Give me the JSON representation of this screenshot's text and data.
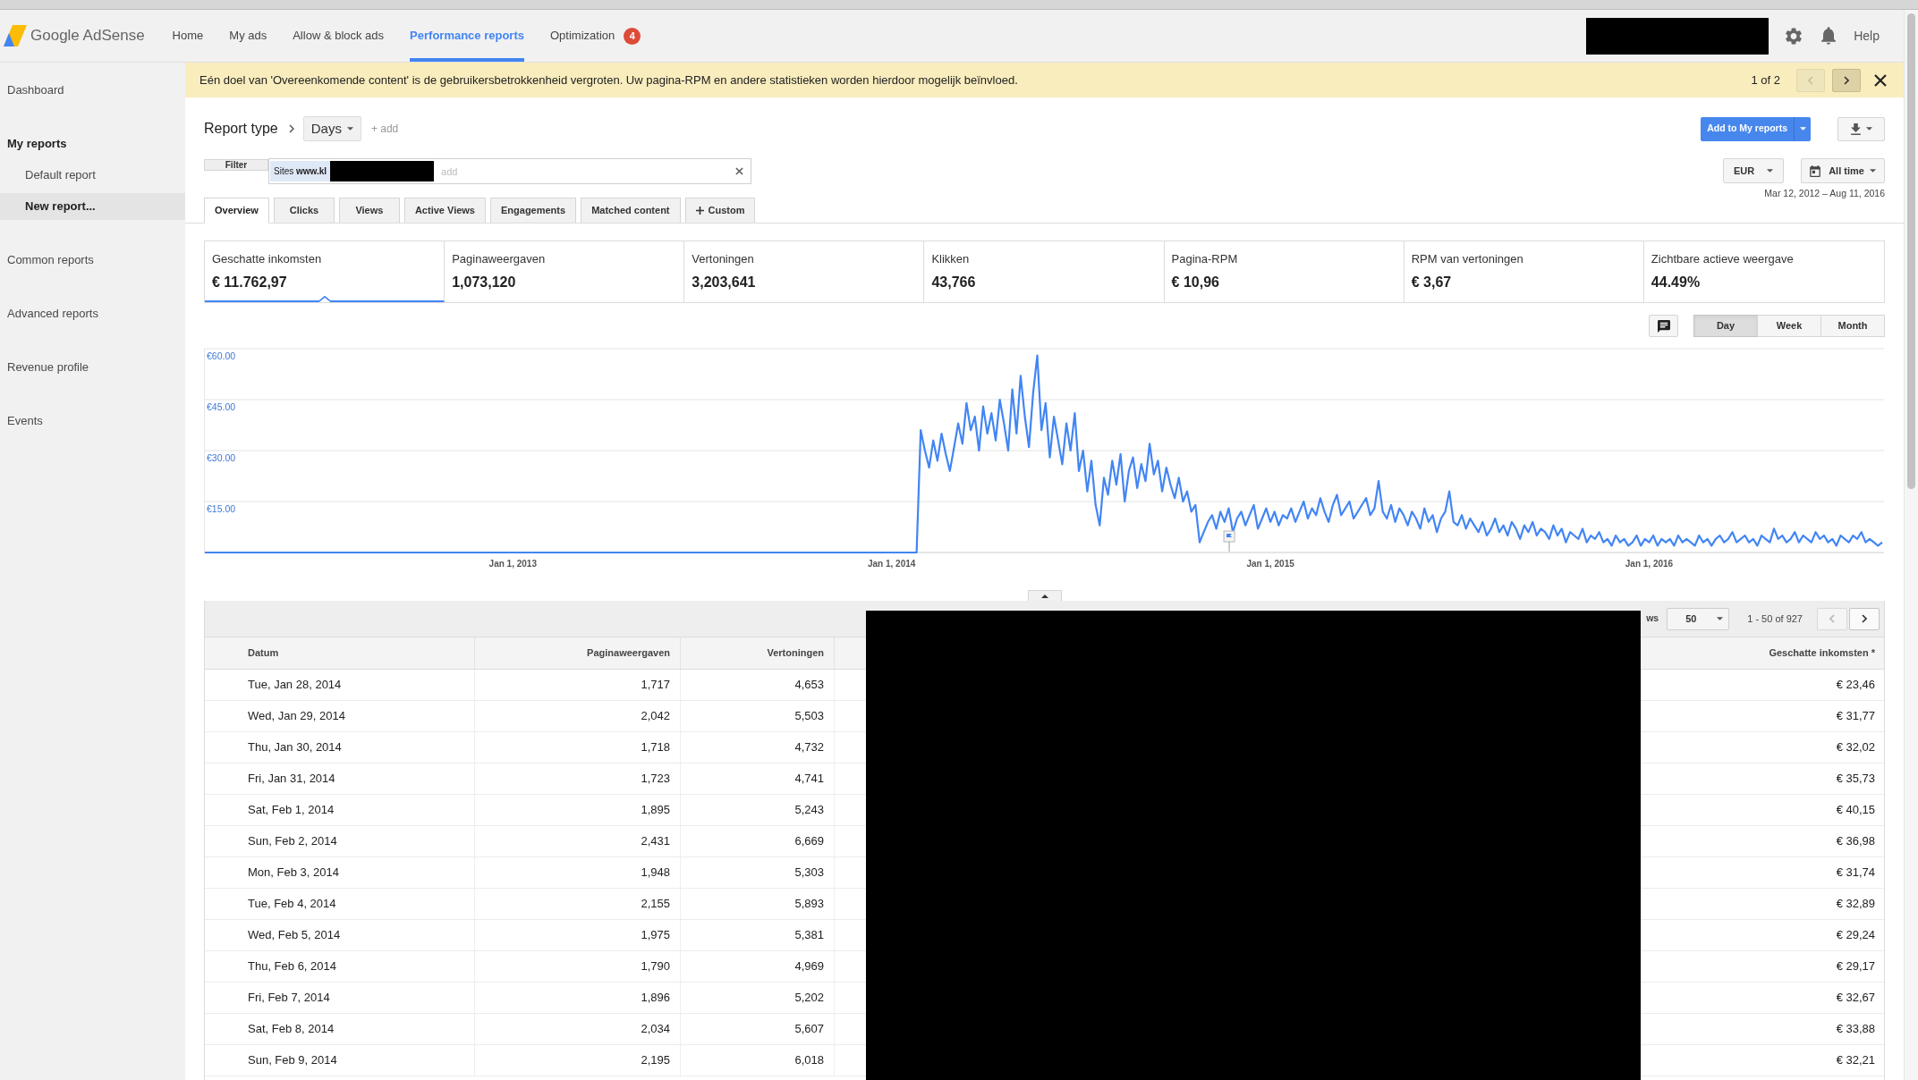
{
  "header": {
    "logo_text": "Google AdSense",
    "nav": [
      {
        "label": "Home",
        "selected": false
      },
      {
        "label": "My ads",
        "selected": false
      },
      {
        "label": "Allow & block ads",
        "selected": false
      },
      {
        "label": "Performance reports",
        "selected": true
      },
      {
        "label": "Optimization",
        "selected": false,
        "badge": "4"
      }
    ],
    "help": "Help"
  },
  "sidebar": {
    "items": [
      {
        "label": "Dashboard",
        "kind": "link",
        "selected": false
      },
      {
        "label": "My reports",
        "kind": "heading",
        "selected": false
      },
      {
        "label": "Default report",
        "kind": "subitem",
        "selected": false
      },
      {
        "label": "New report...",
        "kind": "subitem",
        "selected": true
      },
      {
        "label": "Common reports",
        "kind": "link",
        "selected": false
      },
      {
        "label": "Advanced reports",
        "kind": "link",
        "selected": false
      },
      {
        "label": "Revenue profile",
        "kind": "link",
        "selected": false
      },
      {
        "label": "Events",
        "kind": "link",
        "selected": false
      }
    ]
  },
  "notification": {
    "message": "Eén doel van 'Overeenkomende content' is de gebruikersbetrokkenheid vergroten. Uw pagina-RPM en andere statistieken worden hierdoor mogelijk beïnvloed.",
    "counter": "1 of 2",
    "prev": {
      "disabled": true
    },
    "next": {
      "disabled": false
    }
  },
  "report": {
    "title": "Report type",
    "dimension": "Days",
    "add_dimension": "+ add",
    "add_to_reports": "Add to My reports",
    "filter": {
      "label": "Filter",
      "chip": "Sites **www.kl**",
      "placeholder": "add"
    },
    "currency": "EUR",
    "date_button": "All time",
    "date_range": "Mar 12, 2012 – Aug 11, 2016"
  },
  "tabs": [
    {
      "label": "Overview",
      "kind": "tab",
      "selected": true
    },
    {
      "label": "Clicks",
      "kind": "tab",
      "selected": false
    },
    {
      "label": "Views",
      "kind": "tab",
      "selected": false
    },
    {
      "label": "Active Views",
      "kind": "tab",
      "selected": false
    },
    {
      "label": "Engagements",
      "kind": "tab",
      "selected": false
    },
    {
      "label": "Matched content",
      "kind": "tab",
      "selected": false
    },
    {
      "label": "Custom",
      "kind": "add",
      "selected": false
    }
  ],
  "metrics": [
    {
      "label": "Geschatte inkomsten",
      "value": "€ 11.762,97",
      "selected": true
    },
    {
      "label": "Paginaweergaven",
      "value": "1,073,120",
      "selected": false
    },
    {
      "label": "Vertoningen",
      "value": "3,203,641",
      "selected": false
    },
    {
      "label": "Klikken",
      "value": "43,766",
      "selected": false
    },
    {
      "label": "Pagina-RPM",
      "value": "€ 10,96",
      "selected": false
    },
    {
      "label": "RPM van vertoningen",
      "value": "€ 3,67",
      "selected": false
    },
    {
      "label": "Zichtbare actieve weergave",
      "value": "44.49%",
      "selected": false
    }
  ],
  "chart": {
    "granularity": [
      {
        "label": "Day",
        "selected": true
      },
      {
        "label": "Week",
        "selected": false
      },
      {
        "label": "Month",
        "selected": false
      }
    ],
    "chart_data": {
      "type": "line",
      "grid": true,
      "categories": [
        null,
        null,
        null,
        null,
        null,
        null,
        null,
        null,
        null,
        null,
        null,
        null,
        null,
        null,
        null,
        null,
        null,
        null,
        null,
        null,
        null,
        null,
        null,
        null,
        null,
        null,
        null,
        null,
        null,
        null,
        null,
        null,
        null,
        null,
        null,
        null,
        null,
        null,
        null,
        null,
        null,
        null,
        null,
        null,
        null,
        null,
        null,
        null,
        null,
        null,
        null,
        null,
        null,
        null,
        null,
        null,
        null,
        null,
        null,
        null,
        null,
        null,
        null,
        null,
        null,
        null,
        null,
        null,
        null,
        null,
        null,
        null,
        null,
        null,
        "Jan 1, 2013",
        null,
        null,
        null,
        null,
        null,
        null,
        null,
        null,
        null,
        null,
        null,
        null,
        null,
        null,
        null,
        null,
        null,
        null,
        null,
        null,
        null,
        null,
        null,
        null,
        null,
        null,
        null,
        null,
        null,
        null,
        null,
        null,
        null,
        null,
        null,
        null,
        null,
        null,
        null,
        null,
        null,
        null,
        null,
        null,
        null,
        null,
        null,
        null,
        null,
        null,
        null,
        null,
        null,
        null,
        null,
        null,
        null,
        null,
        null,
        null,
        null,
        null,
        null,
        null,
        null,
        null,
        null,
        null,
        null,
        null,
        null,
        null,
        null,
        null,
        null,
        null,
        null,
        null,
        null,
        null,
        null,
        null,
        null,
        null,
        null,
        null,
        null,
        null,
        null,
        null,
        "Jan 1, 2014",
        null,
        null,
        null,
        null,
        null,
        null,
        null,
        null,
        null,
        null,
        null,
        null,
        null,
        null,
        null,
        null,
        null,
        null,
        null,
        null,
        null,
        null,
        null,
        null,
        null,
        null,
        null,
        null,
        null,
        null,
        null,
        null,
        null,
        null,
        null,
        null,
        null,
        null,
        null,
        null,
        null,
        null,
        null,
        null,
        null,
        null,
        null,
        null,
        null,
        null,
        null,
        null,
        null,
        null,
        null,
        null,
        null,
        null,
        null,
        null,
        null,
        null,
        null,
        null,
        null,
        null,
        null,
        null,
        null,
        null,
        null,
        null,
        null,
        null,
        null,
        null,
        null,
        null,
        null,
        null,
        null,
        null,
        null,
        null,
        null,
        null,
        null,
        null,
        null,
        null,
        "Jan 1, 2015",
        null,
        null,
        null,
        null,
        null,
        null,
        null,
        null,
        null,
        null,
        null,
        null,
        null,
        null,
        null,
        null,
        null,
        null,
        null,
        null,
        null,
        null,
        null,
        null,
        null,
        null,
        null,
        null,
        null,
        null,
        null,
        null,
        null,
        null,
        null,
        null,
        null,
        null,
        null,
        null,
        null,
        null,
        null,
        null,
        null,
        null,
        null,
        null,
        null,
        null,
        null,
        null,
        null,
        null,
        null,
        null,
        null,
        null,
        null,
        null,
        null,
        null,
        null,
        null,
        null,
        null,
        null,
        null,
        null,
        null,
        null,
        null,
        null,
        null,
        null,
        null,
        null,
        null,
        null,
        null,
        null,
        null,
        null,
        null,
        null,
        null,
        null,
        null,
        null,
        null,
        "Jan 1, 2016",
        null,
        null,
        null,
        null,
        null,
        null,
        null,
        null,
        null,
        null,
        null,
        null,
        null,
        null,
        null,
        null,
        null,
        null,
        null,
        null,
        null,
        null,
        null,
        null,
        null,
        null,
        null,
        null,
        null,
        null,
        null,
        null,
        null,
        null,
        null,
        null,
        null,
        null,
        null,
        null,
        null,
        null,
        null,
        null,
        null,
        null,
        null,
        null,
        null,
        null,
        null,
        null,
        null,
        null,
        null,
        null
      ],
      "series": [
        {
          "color": "#4285f4",
          "values": [
            0,
            0,
            0,
            0,
            0,
            0,
            0,
            0,
            0,
            0,
            0,
            0,
            0,
            0,
            0,
            0,
            0,
            0,
            0,
            0,
            0,
            0,
            0,
            0,
            0,
            0,
            0,
            0,
            0,
            0,
            0,
            0,
            0,
            0,
            0,
            0,
            0,
            0,
            0,
            0,
            0,
            0,
            0,
            0,
            0,
            0,
            0,
            0,
            0,
            0,
            0,
            0,
            0,
            0,
            0,
            0,
            0,
            0,
            0,
            0,
            0,
            0,
            0,
            0,
            0,
            0,
            0,
            0,
            0,
            0,
            0,
            0,
            0,
            0,
            0,
            0,
            0,
            0,
            0,
            0,
            0,
            0,
            0,
            0,
            0,
            0,
            0,
            0,
            0,
            0,
            0,
            0,
            0,
            0,
            0,
            0,
            0,
            0,
            0,
            0,
            0,
            0,
            0,
            0,
            0,
            0,
            0,
            0,
            0,
            0,
            0,
            0,
            0,
            0,
            0,
            0,
            0,
            0,
            0,
            0,
            0,
            0,
            0,
            0,
            0,
            0,
            0,
            0,
            0,
            0,
            0,
            0,
            0,
            0,
            0,
            0,
            0,
            0,
            0,
            0,
            0,
            0,
            0,
            0,
            0,
            0,
            0,
            0,
            0,
            0,
            0,
            0,
            0,
            0,
            0,
            0,
            0,
            0,
            0,
            0,
            0,
            0,
            0,
            0,
            0,
            0,
            0,
            0,
            0,
            0,
            0,
            0,
            36,
            30,
            25,
            33,
            27,
            35,
            29,
            24,
            31,
            38,
            32,
            44,
            36,
            40,
            30,
            43,
            35,
            41,
            33,
            45,
            38,
            30,
            48,
            35,
            52,
            40,
            31,
            47,
            58,
            36,
            44,
            28,
            40,
            33,
            26,
            38,
            30,
            41,
            24,
            30,
            18,
            27,
            14,
            8,
            22,
            17,
            27,
            20,
            29,
            15,
            24,
            28,
            19,
            26,
            21,
            32,
            23,
            27,
            18,
            25,
            20,
            16,
            22,
            15,
            18,
            12,
            14,
            3,
            6,
            9,
            11,
            7,
            12,
            9,
            13,
            6,
            10,
            12,
            8,
            11,
            14,
            7,
            10,
            13,
            9,
            12,
            8,
            11,
            10,
            13,
            9,
            12,
            15,
            10,
            13,
            11,
            16,
            12,
            9,
            14,
            17,
            11,
            13,
            15,
            10,
            12,
            14,
            16,
            11,
            13,
            21,
            12,
            10,
            14,
            9,
            13,
            11,
            8,
            12,
            10,
            7,
            13,
            9,
            11,
            6,
            10,
            12,
            18,
            9,
            8,
            11,
            7,
            10,
            8,
            6,
            9,
            5,
            7,
            10,
            6,
            8,
            5,
            9,
            7,
            4,
            8,
            6,
            9,
            5,
            7,
            6,
            4,
            8,
            5,
            7,
            3,
            6,
            5,
            4,
            7,
            3,
            5,
            4,
            6,
            3,
            4,
            2,
            5,
            3,
            4,
            2,
            3,
            5,
            2,
            4,
            3,
            5,
            2,
            4,
            3,
            4,
            2,
            5,
            3,
            4,
            3,
            2,
            5,
            3,
            4,
            2,
            4,
            5,
            3,
            4,
            6,
            3,
            4,
            5,
            3,
            4,
            2,
            5,
            4,
            3,
            7,
            4,
            5,
            3,
            4,
            6,
            3,
            5,
            4,
            3,
            6,
            4,
            5,
            3,
            4,
            2,
            5,
            4,
            3,
            5,
            4,
            6,
            3,
            4,
            3,
            2,
            3
          ]
        }
      ],
      "ylim": [
        0,
        60
      ],
      "yticks": [
        {
          "value": 15,
          "label": "€15.00"
        },
        {
          "value": 30,
          "label": "€30.00"
        },
        {
          "value": 45,
          "label": "€45.00"
        },
        {
          "value": 60,
          "label": "€60.00"
        }
      ]
    }
  },
  "table": {
    "rows_label": "ws",
    "page_size": "50",
    "page_info": "1 - 50 of 927",
    "prev": {
      "disabled": true
    },
    "next": {
      "disabled": false
    },
    "columns": [
      "Datum",
      "Paginaweergaven",
      "Vertoningen",
      "Geschatte inkomsten *"
    ],
    "rows": [
      [
        "Tue, Jan 28, 2014",
        "1,717",
        "4,653",
        "€ 23,46"
      ],
      [
        "Wed, Jan 29, 2014",
        "2,042",
        "5,503",
        "€ 31,77"
      ],
      [
        "Thu, Jan 30, 2014",
        "1,718",
        "4,732",
        "€ 32,02"
      ],
      [
        "Fri, Jan 31, 2014",
        "1,723",
        "4,741",
        "€ 35,73"
      ],
      [
        "Sat, Feb 1, 2014",
        "1,895",
        "5,243",
        "€ 40,15"
      ],
      [
        "Sun, Feb 2, 2014",
        "2,431",
        "6,669",
        "€ 36,98"
      ],
      [
        "Mon, Feb 3, 2014",
        "1,948",
        "5,303",
        "€ 31,74"
      ],
      [
        "Tue, Feb 4, 2014",
        "2,155",
        "5,893",
        "€ 32,89"
      ],
      [
        "Wed, Feb 5, 2014",
        "1,975",
        "5,381",
        "€ 29,24"
      ],
      [
        "Thu, Feb 6, 2014",
        "1,790",
        "4,969",
        "€ 29,17"
      ],
      [
        "Fri, Feb 7, 2014",
        "1,896",
        "5,202",
        "€ 32,67"
      ],
      [
        "Sat, Feb 8, 2014",
        "2,034",
        "5,607",
        "€ 33,88"
      ],
      [
        "Sun, Feb 9, 2014",
        "2,195",
        "6,018",
        "€ 32,21"
      ]
    ]
  }
}
